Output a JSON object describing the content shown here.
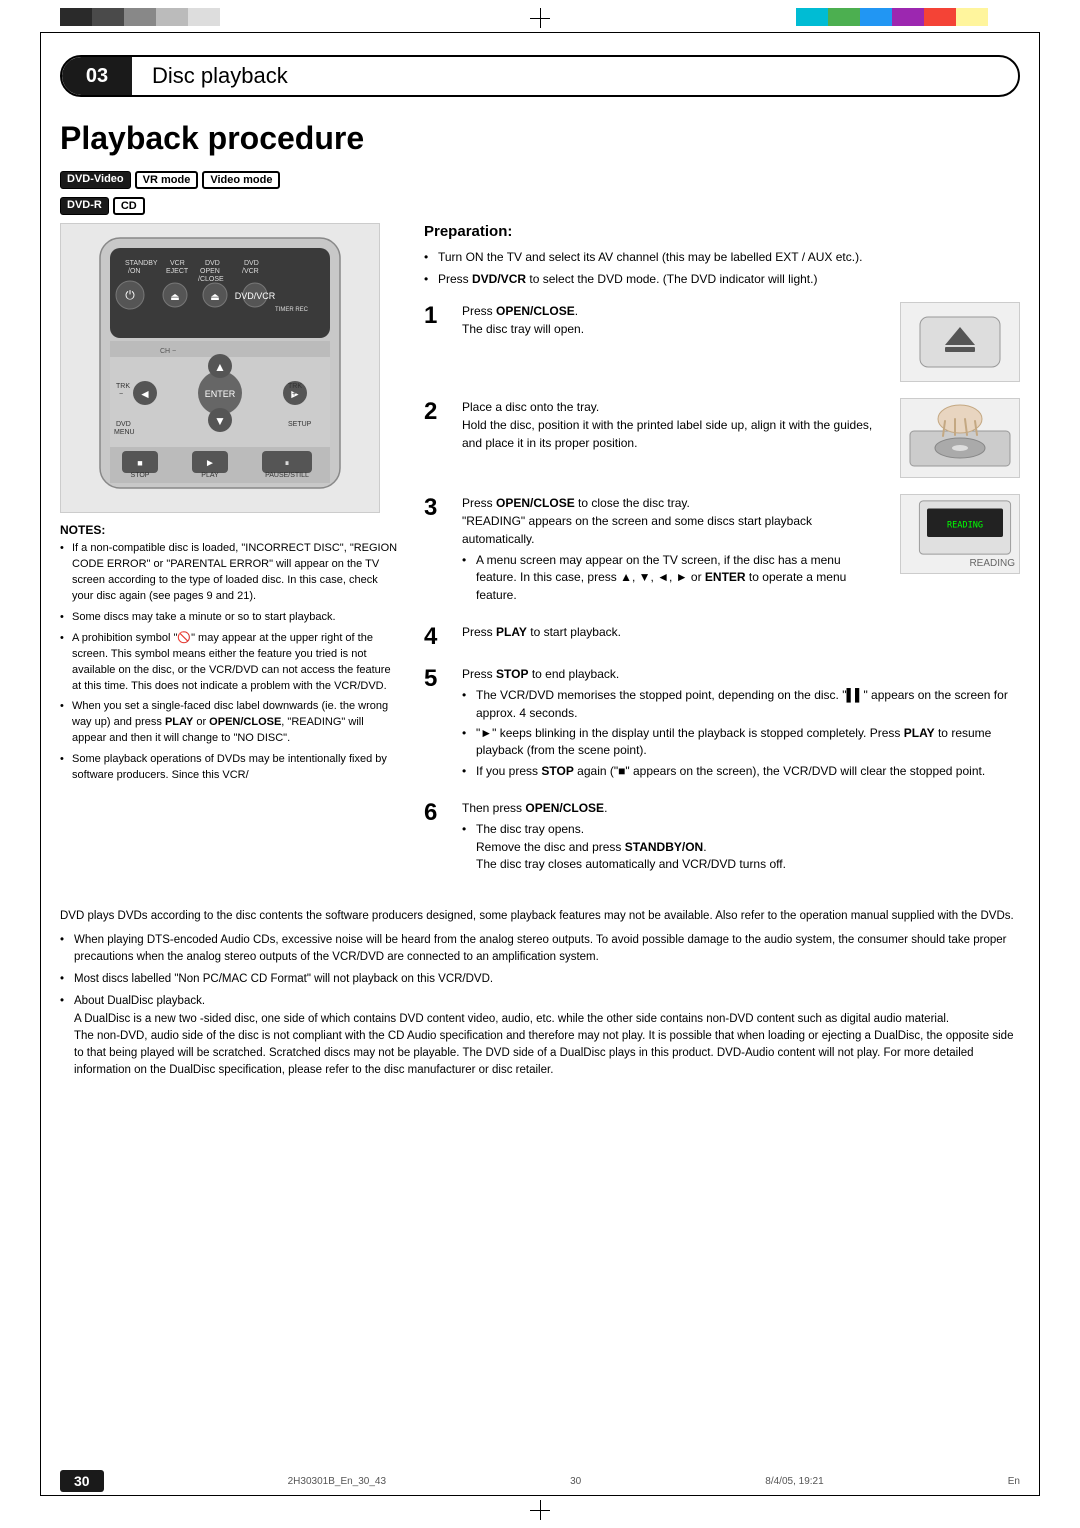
{
  "page": {
    "number": "30",
    "lang": "En",
    "footer_left": "2H30301B_En_30_43",
    "footer_center": "30",
    "footer_right": "8/4/05, 19:21"
  },
  "chapter": {
    "number": "03",
    "title": "Disc playback"
  },
  "section": {
    "title": "Playback procedure"
  },
  "badges": [
    {
      "label": "DVD-Video",
      "style": "filled"
    },
    {
      "label": "VR mode",
      "style": "outline"
    },
    {
      "label": "Video mode",
      "style": "outline"
    },
    {
      "label": "DVD-R",
      "style": "filled"
    },
    {
      "label": "CD",
      "style": "outline"
    }
  ],
  "preparation": {
    "title": "Preparation:",
    "items": [
      "Turn ON the TV and select its AV channel (this may be labelled EXT / AUX etc.).",
      "Press DVD/VCR to select the DVD mode. (The DVD indicator will light.)"
    ]
  },
  "steps": [
    {
      "num": "1",
      "text": "Press OPEN/CLOSE.",
      "sub": "The disc tray will open.",
      "has_image": true,
      "image_label": "eject button"
    },
    {
      "num": "2",
      "text": "Place a disc onto the tray.",
      "sub_lines": [
        "Hold the disc, position it with the printed label side up, align it with the guides, and place it in its proper position."
      ],
      "has_image": true,
      "image_label": "disc tray"
    },
    {
      "num": "3",
      "text": "Press OPEN/CLOSE to close the disc tray.",
      "sub_lines": [
        "\"READING\" appears on the screen and some discs start playback automatically.",
        "A menu screen may appear on the TV screen, if the disc has a menu feature. In this case, press ▲, ▼, ◄, ► or ENTER to operate a menu feature."
      ],
      "has_image": true,
      "image_label": "READING",
      "reading_label": "READING"
    },
    {
      "num": "4",
      "text": "Press PLAY to start playback.",
      "sub_lines": []
    },
    {
      "num": "5",
      "text": "Press STOP to end playback.",
      "sub_lines": [
        "The VCR/DVD memorises the stopped point, depending on the disc. \"▌▌\" appears on the screen for approx. 4 seconds.",
        "\"►\" keeps blinking in the display until the playback is stopped completely. Press PLAY to resume playback (from the scene point).",
        "If you press STOP again (\"■\" appears on the screen), the VCR/DVD will clear the stopped point."
      ]
    },
    {
      "num": "6",
      "text": "Then press OPEN/CLOSE.",
      "sub_lines": [
        "The disc tray opens.",
        "Remove the disc and press STANDBY/ON.",
        "The disc tray closes automatically and VCR/DVD turns off."
      ]
    }
  ],
  "notes": {
    "title": "NOTES:",
    "items": [
      "If a non-compatible disc is loaded, \"INCORRECT DISC\", \"REGION CODE ERROR\" or \"PARENTAL ERROR\" will appear on the TV screen according to the type of loaded disc. In this case, check your disc again (see pages 9 and 21).",
      "Some discs may take a minute or so to start playback.",
      "A prohibition symbol \"🚫\" may appear at the upper right of the screen. This symbol means either the feature you tried is not available on the disc, or the VCR/DVD can not access the feature at this time. This does not indicate a problem with the VCR/DVD.",
      "When you set a single-faced disc label downwards (ie. the wrong way up) and press PLAY or OPEN/CLOSE, \"READING\" will appear and then it will change to \"NO DISC\".",
      "Some playback operations of DVDs may be intentionally fixed by software producers. Since this VCR/"
    ]
  },
  "bottom_text": [
    "DVD plays DVDs according to the disc contents the software producers designed, some playback features may not be available. Also refer to the operation manual supplied with the DVDs.",
    "When playing DTS-encoded Audio CDs, excessive noise will be heard from the analog stereo outputs. To avoid possible damage to the audio system, the consumer should take proper precautions when the analog stereo outputs of the VCR/DVD are connected to an amplification system.",
    "Most discs labelled \"Non PC/MAC CD Format\" will not playback on this VCR/DVD.",
    "About DualDisc playback.",
    "A DualDisc is a new two -sided disc, one side of which contains DVD content video, audio, etc. while the other side contains non-DVD content such as digital audio material.",
    "The non-DVD, audio side of the disc is not compliant with the CD Audio specification and therefore may not play. It is possible that when loading or ejecting a DualDisc, the opposite side to that being played will be scratched. Scratched discs may not be playable. The DVD side of a DualDisc plays in this product. DVD-Audio content will not play. For more detailed information on the DualDisc specification, please refer to the disc manufacturer or disc retailer."
  ],
  "colors": {
    "black": "#1a1a1a",
    "accent": "#000000",
    "light_gray": "#e8e8e8"
  }
}
